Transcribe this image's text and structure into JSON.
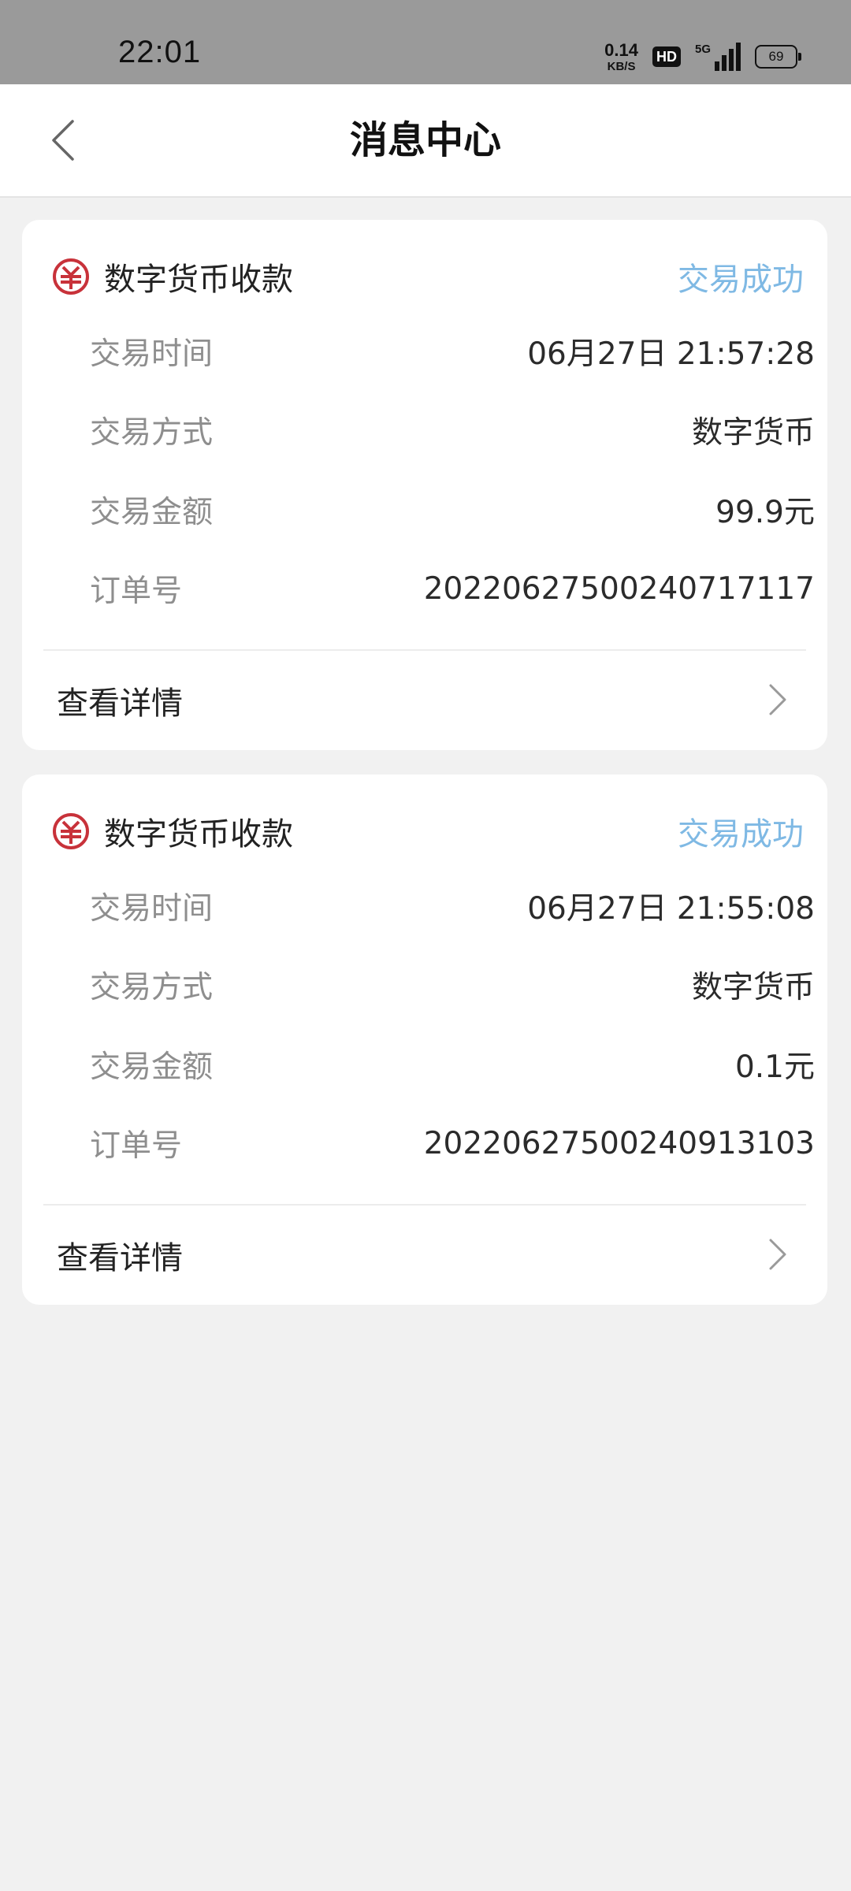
{
  "status_bar": {
    "time": "22:01",
    "net_speed_value": "0.14",
    "net_speed_unit": "KB/S",
    "hd_label": "HD",
    "signal_label": "5G",
    "battery": "69"
  },
  "header": {
    "title": "消息中心"
  },
  "messages": [
    {
      "title": "数字货币收款",
      "status": "交易成功",
      "fields": [
        {
          "label": "交易时间",
          "value": "06月27日 21:57:28"
        },
        {
          "label": "交易方式",
          "value": "数字货币"
        },
        {
          "label": "交易金额",
          "value": "99.9元"
        },
        {
          "label": "订单号",
          "value": "20220627500240717117"
        }
      ],
      "detail_label": "查看详情"
    },
    {
      "title": "数字货币收款",
      "status": "交易成功",
      "fields": [
        {
          "label": "交易时间",
          "value": "06月27日 21:55:08"
        },
        {
          "label": "交易方式",
          "value": "数字货币"
        },
        {
          "label": "交易金额",
          "value": "0.1元"
        },
        {
          "label": "订单号",
          "value": "20220627500240913103"
        }
      ],
      "detail_label": "查看详情"
    }
  ],
  "colors": {
    "accent_status": "#7fb9e4",
    "ecny_red": "#c8323a",
    "page_background": "#f1f1f1",
    "status_bar_background": "#9a9a9a"
  },
  "icons": {
    "back": "chevron-left-icon",
    "currency": "ecny-icon",
    "detail_arrow": "chevron-right-icon"
  }
}
